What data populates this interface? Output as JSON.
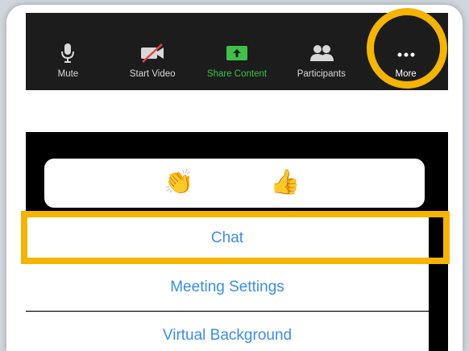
{
  "toolbar": {
    "items": [
      {
        "label": "Mute",
        "icon": "microphone-icon"
      },
      {
        "label": "Start Video",
        "icon": "video-off-icon"
      },
      {
        "label": "Share Content",
        "icon": "share-screen-icon"
      },
      {
        "label": "Participants",
        "icon": "participants-icon"
      },
      {
        "label": "More",
        "icon": "more-dots-icon"
      }
    ]
  },
  "reactions": {
    "items": [
      "👏",
      "👍"
    ]
  },
  "menu": {
    "items": [
      {
        "label": "Chat"
      },
      {
        "label": "Meeting Settings"
      },
      {
        "label": "Virtual Background"
      }
    ]
  },
  "colors": {
    "highlight": "#f4b400",
    "link_blue": "#3a8ee6",
    "share_green": "#3fc04a",
    "toolbar_bg": "#1c1c1c"
  }
}
